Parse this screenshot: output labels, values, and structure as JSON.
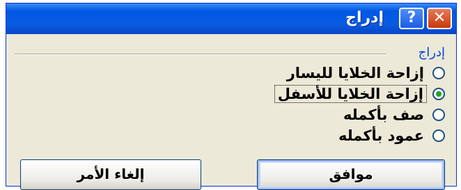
{
  "dialog": {
    "title": "إدراج",
    "help_label": "?",
    "close_label": "✕",
    "group_label": "إدراج",
    "options": [
      {
        "label": "إزاحة الخلايا لليسار",
        "selected": false
      },
      {
        "label": "إزاحة الخلايا للأسفل",
        "selected": true
      },
      {
        "label": "صف بأكمله",
        "selected": false
      },
      {
        "label": "عمود بأكمله",
        "selected": false
      }
    ],
    "ok_label": "موافق",
    "cancel_label": "إلغاء الأمر"
  }
}
